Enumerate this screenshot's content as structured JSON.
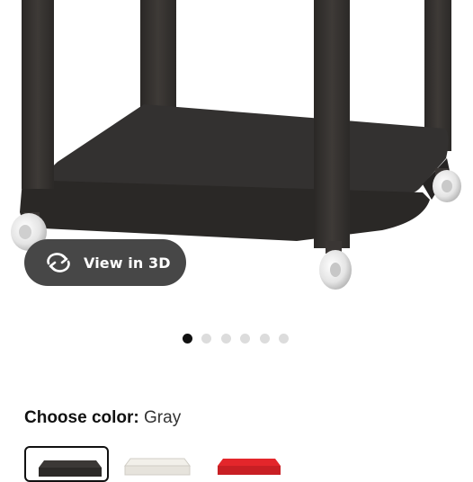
{
  "product_image": {
    "icon": "side-table-on-casters-photo",
    "color": "#3b3836"
  },
  "view_3d": {
    "label": "View in 3D",
    "icon": "rotate-3d-icon",
    "bg_color": "#474747"
  },
  "carousel": {
    "total": 6,
    "active_index": 0
  },
  "color_picker": {
    "label": "Choose color:",
    "selected_value": "Gray",
    "swatches": [
      {
        "name": "Gray",
        "color": "#3b3836",
        "selected": true
      },
      {
        "name": "White",
        "color": "#f2f0ea",
        "selected": false
      },
      {
        "name": "Red",
        "color": "#e3262b",
        "selected": false
      }
    ]
  }
}
